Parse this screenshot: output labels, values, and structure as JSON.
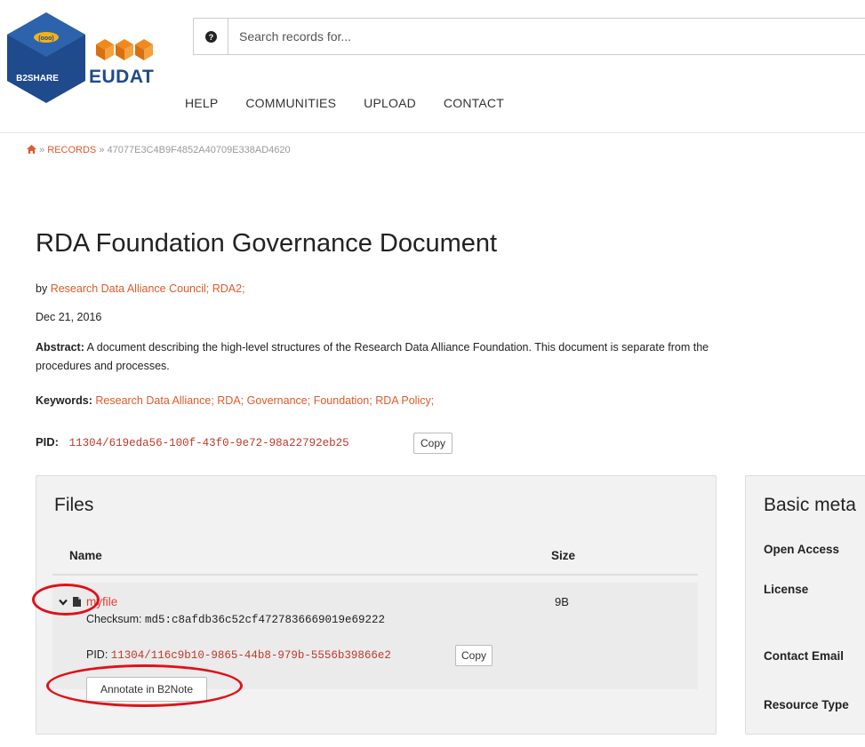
{
  "brand": {
    "b2share_logo_text": "B2SHARE",
    "eudat_logo_text": "EUDAT"
  },
  "search": {
    "placeholder": "Search records for..."
  },
  "nav": {
    "items": [
      "HELP",
      "COMMUNITIES",
      "UPLOAD",
      "CONTACT"
    ]
  },
  "breadcrumb": {
    "separator": "»",
    "records": "RECORDS",
    "current": "47077E3C4B9F4852A40709E338AD4620"
  },
  "record": {
    "title": "RDA Foundation Governance Document",
    "by_label": "by",
    "creators": [
      "Research Data Alliance Council;",
      "RDA2;"
    ],
    "date": "Dec 21, 2016",
    "abstract_label": "Abstract:",
    "abstract_line1": "A document describing the high-level structures of the Research Data Alliance Foundation. This document is separate from the",
    "abstract_line2": "procedures and processes.",
    "keywords_label": "Keywords:",
    "keywords": [
      "Research Data Alliance;",
      "RDA;",
      "Governance;",
      "Foundation;",
      "RDA Policy;"
    ],
    "pid_label": "PID:",
    "pid": "11304/619eda56-100f-43f0-9e72-98a22792eb25",
    "copy_label": "Copy"
  },
  "files": {
    "title": "Files",
    "col_name": "Name",
    "col_size": "Size",
    "rows": [
      {
        "name": "myfile",
        "size": "9B",
        "checksum_label": "Checksum:",
        "checksum": "md5:c8afdb36c52cf4727836669019e69222",
        "pid_label": "PID:",
        "pid": "11304/116c9b10-9865-44b8-979b-5556b39866e2",
        "copy_label": "Copy",
        "annotate_label": "Annotate in B2Note"
      }
    ]
  },
  "basic_metadata": {
    "title": "Basic meta",
    "fields": [
      "Open Access",
      "License",
      "Contact Email",
      "Resource Type"
    ]
  },
  "colors": {
    "accent": "#e05a2b",
    "annotation_circle": "#e0101a"
  }
}
